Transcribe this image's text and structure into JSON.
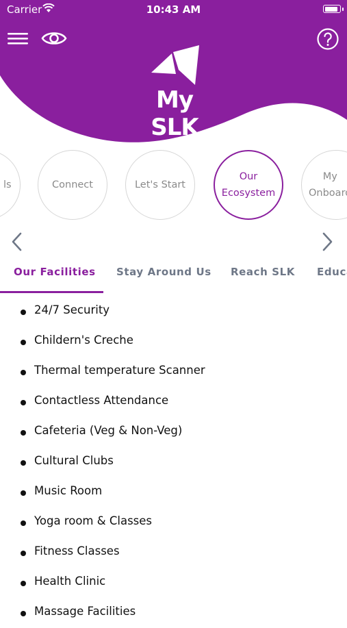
{
  "status_bar": {
    "carrier": "Carrier",
    "time": "10:43 AM",
    "battery_level": 0.9
  },
  "header": {
    "app_name": "My SLK",
    "brand_color": "#8a1f9e",
    "icons": [
      "hamburger-menu-icon",
      "eye-icon",
      "help-icon"
    ]
  },
  "nav_circles": [
    {
      "label": "ls",
      "active": false
    },
    {
      "label": "Connect",
      "active": false
    },
    {
      "label": "Let's Start",
      "active": false
    },
    {
      "label": "Our\nEcosystem",
      "active": true
    },
    {
      "label": "My\nOnboard",
      "active": false
    }
  ],
  "tabs": [
    {
      "label": "Our Facilities",
      "active": true
    },
    {
      "label": "Stay Around Us",
      "active": false
    },
    {
      "label": "Reach SLK",
      "active": false
    },
    {
      "label": "Educa",
      "active": false
    }
  ],
  "facilities": [
    "24/7 Security",
    "Childern's Creche",
    "Thermal temperature Scanner",
    "Contactless Attendance",
    "Cafeteria (Veg & Non-Veg)",
    "Cultural Clubs",
    "Music Room",
    "Yoga room & Classes",
    "Fitness Classes",
    "Health Clinic",
    "Massage Facilities"
  ]
}
